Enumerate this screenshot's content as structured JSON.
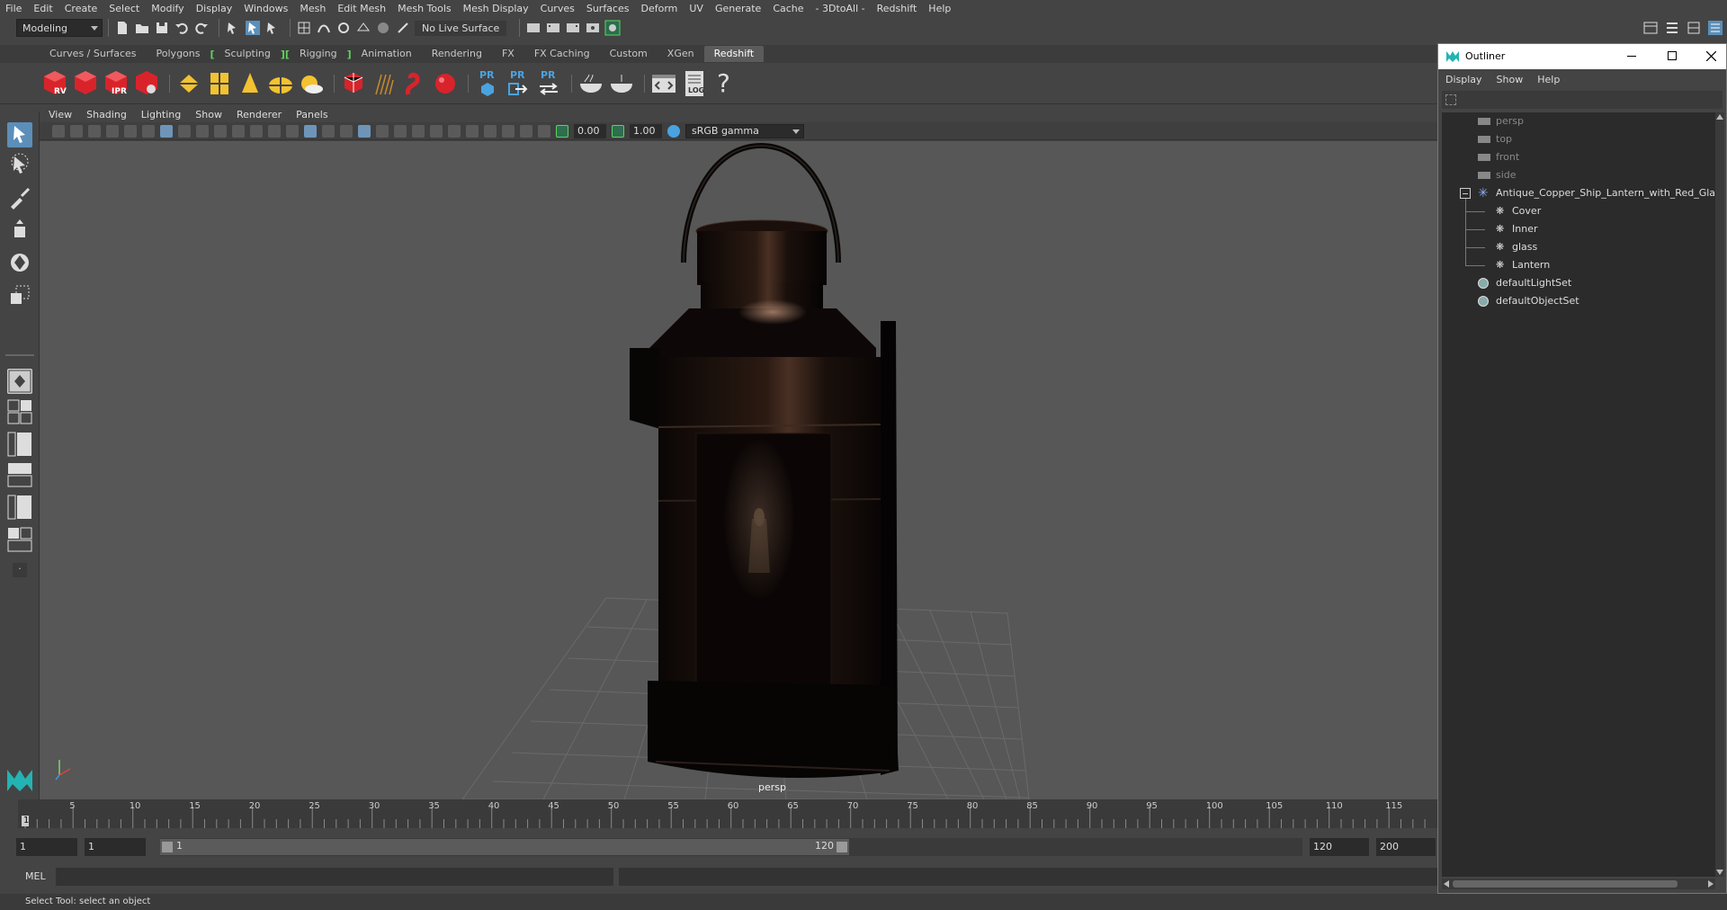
{
  "menubar": {
    "items": [
      "File",
      "Edit",
      "Create",
      "Select",
      "Modify",
      "Display",
      "Windows",
      "Mesh",
      "Edit Mesh",
      "Mesh Tools",
      "Mesh Display",
      "Curves",
      "Surfaces",
      "Deform",
      "UV",
      "Generate",
      "Cache",
      "- 3DtoAll -",
      "Redshift",
      "Help"
    ]
  },
  "statusline": {
    "mode": "Modeling",
    "live_surface": "No Live Surface"
  },
  "shelf": {
    "tabs": [
      "Curves / Surfaces",
      "Polygons",
      "Sculpting",
      "Rigging",
      "Animation",
      "Rendering",
      "FX",
      "FX Caching",
      "Custom",
      "XGen",
      "Redshift"
    ],
    "active_tab": "Redshift",
    "rs_labels": [
      "RV",
      "",
      "IPR",
      ""
    ],
    "pr_labels": [
      "PR",
      "PR",
      "PR"
    ],
    "log_label": "LOG",
    "help_glyph": "?"
  },
  "panel": {
    "menu": [
      "View",
      "Shading",
      "Lighting",
      "Show",
      "Renderer",
      "Panels"
    ],
    "exposure": "0.00",
    "gamma": "1.00",
    "color_space": "sRGB gamma",
    "camera_label": "persp"
  },
  "timeline": {
    "ticks": [
      "5",
      "10",
      "15",
      "20",
      "25",
      "30",
      "35",
      "40",
      "45",
      "50",
      "55",
      "60",
      "65",
      "70",
      "75",
      "80",
      "85",
      "90",
      "95",
      "100",
      "105",
      "110",
      "115"
    ],
    "current_frame": "1"
  },
  "range": {
    "start": "1",
    "current": "1",
    "slider_start": "1",
    "slider_end": "120",
    "end": "120",
    "max": "200"
  },
  "cmdline": {
    "label": "MEL"
  },
  "helpline": {
    "text": "Select Tool: select an object"
  },
  "outliner": {
    "title": "Outliner",
    "menu": [
      "Display",
      "Show",
      "Help"
    ],
    "cameras": [
      "persp",
      "top",
      "front",
      "side"
    ],
    "group": "Antique_Copper_Ship_Lantern_with_Red_Glass_",
    "children": [
      "Cover",
      "Inner",
      "glass",
      "Lantern"
    ],
    "sets": [
      "defaultLightSet",
      "defaultObjectSet"
    ]
  },
  "colors": {
    "accent": "#5fd35f",
    "redshift_red": "#d9232b",
    "tool_yellow": "#f2c230",
    "pr_blue": "#4aa3df"
  }
}
